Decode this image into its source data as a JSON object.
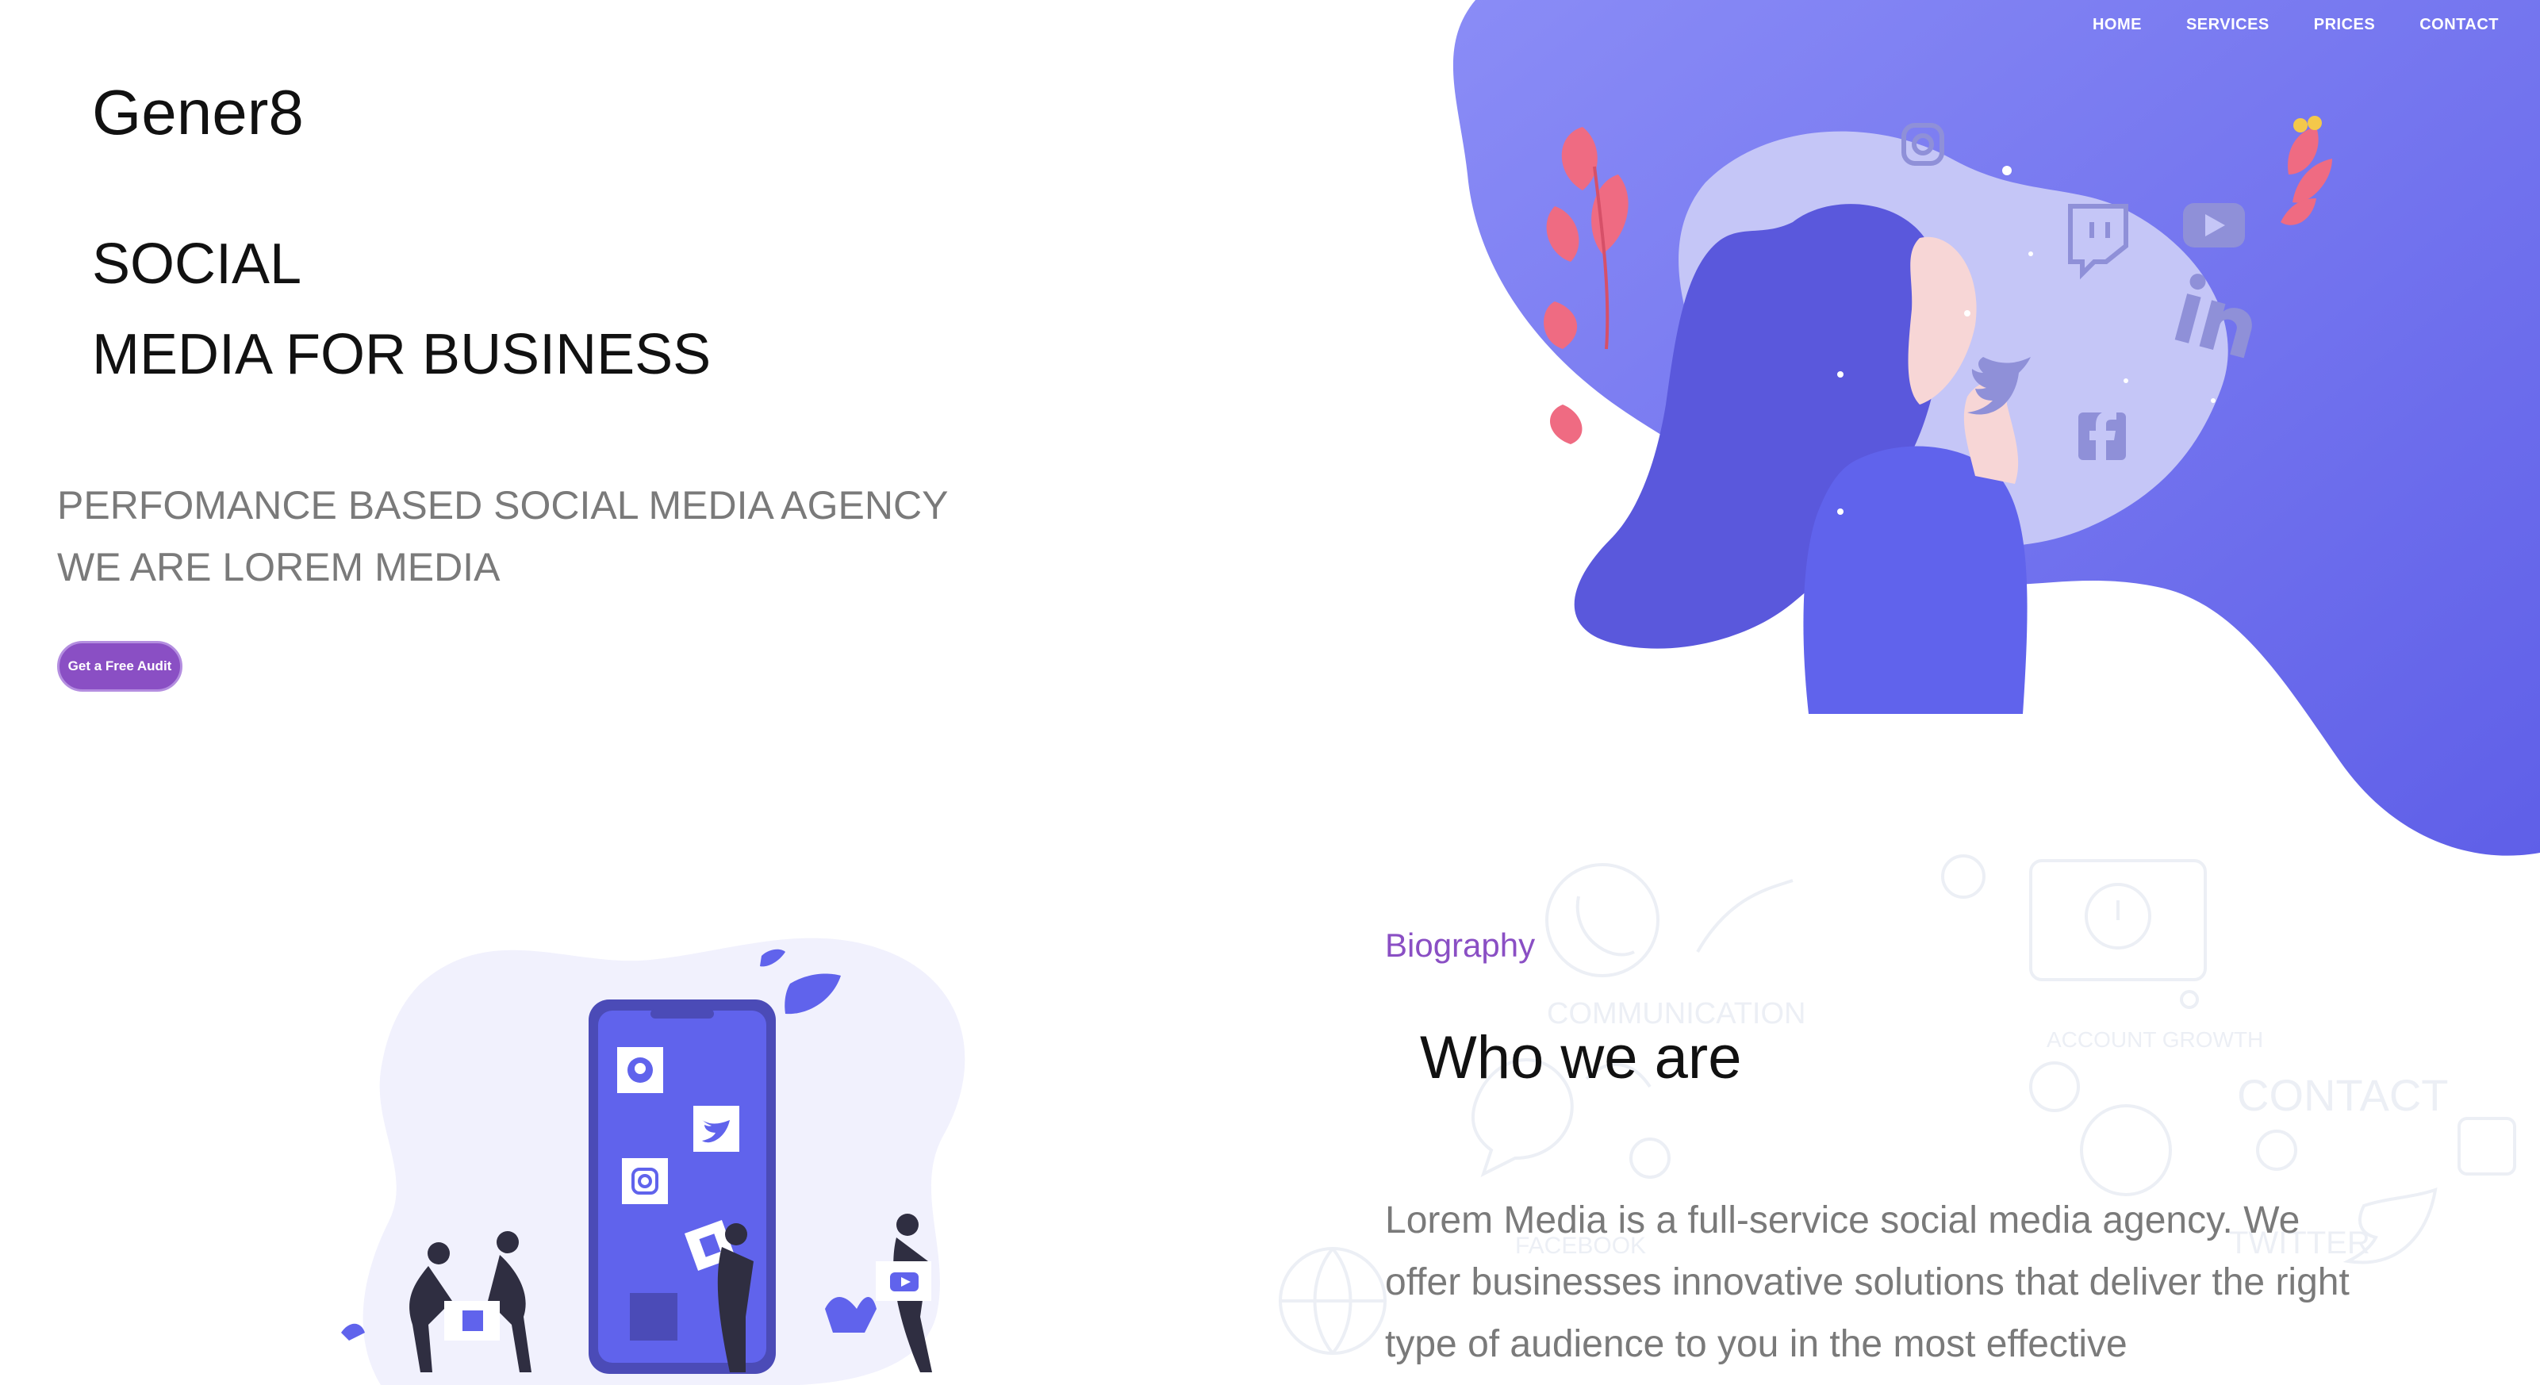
{
  "nav": {
    "items": [
      {
        "label": "HOME"
      },
      {
        "label": "SERVICES"
      },
      {
        "label": "PRICES"
      },
      {
        "label": "CONTACT"
      }
    ]
  },
  "brand": {
    "logo": "Gener8"
  },
  "hero": {
    "headline_line1": "SOCIAL",
    "headline_line2": "MEDIA FOR BUSINESS",
    "subhead_line1": "PERFOMANCE BASED SOCIAL MEDIA AGENCY",
    "subhead_line2": "WE ARE LOREM MEDIA",
    "cta_label": "Get a Free Audit"
  },
  "about": {
    "label": "Biography",
    "title": "Who we are",
    "text": "Lorem Media is a full-service social media agency. We offer businesses innovative solutions that deliver the right type of audience to you in the most effective"
  },
  "colors": {
    "accent": "#8a4fc4",
    "hero_blob": "#6c6ef0",
    "text_dark": "#111111",
    "text_muted": "#7a7a7a"
  },
  "icons": [
    "instagram-icon",
    "twitch-icon",
    "youtube-icon",
    "linkedin-icon",
    "twitter-icon",
    "facebook-icon",
    "pinterest-icon"
  ]
}
